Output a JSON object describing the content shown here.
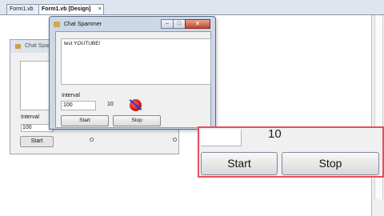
{
  "ide": {
    "tabs": [
      {
        "label": "Form1.vb"
      },
      {
        "label": "Form1.vb [Design]",
        "close": "×"
      }
    ]
  },
  "designer_form": {
    "title": "Chat Spam",
    "interval_label": "Interval",
    "interval_value": "100",
    "start_label": "Start"
  },
  "window": {
    "title": "Chat Spammer",
    "min": "–",
    "max": "□",
    "close": "x",
    "message": "test YOUTUBE!",
    "interval_label": "Interval",
    "interval_value": "100",
    "count": "10",
    "start_label": "Start",
    "stop_label": "Stop"
  },
  "zoom": {
    "count": "10",
    "start_label": "Start",
    "stop_label": "Stop"
  },
  "colors": {
    "highlight": "#e84d5b",
    "close_button": "#c5432b"
  }
}
